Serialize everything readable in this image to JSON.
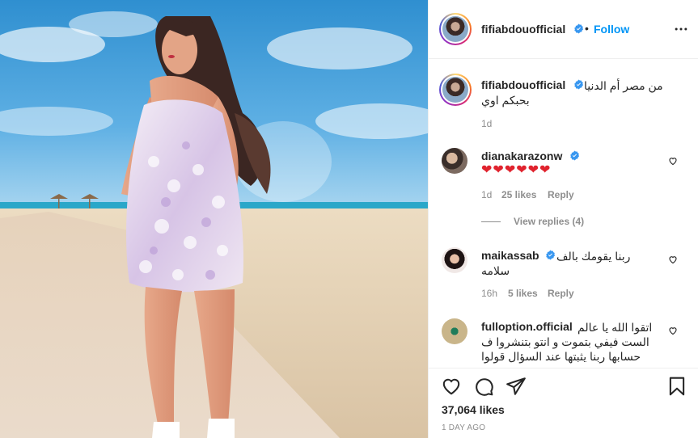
{
  "post": {
    "author": "fifiabdouofficial",
    "follow_label": "Follow",
    "separator": "•",
    "caption": {
      "line1": "من مصر أم الدنيا",
      "line2": "بحبكم اوي",
      "time": "1d"
    }
  },
  "comments": [
    {
      "username": "dianakarazonw",
      "text": "❤❤❤❤❤❤",
      "time": "1d",
      "likes": "25 likes",
      "reply_label": "Reply",
      "view_replies": "View replies (4)"
    },
    {
      "username": "maikassab",
      "line1": "ربنا يقومك بالف",
      "line2": "سلامه",
      "time": "16h",
      "likes": "5 likes",
      "reply_label": "Reply"
    },
    {
      "username": "fulloption.official",
      "line1": "اتقوا الله يا عالم",
      "line2": "الست فيفي بتموت و انتو بتنشروا ف",
      "line3": "حسابها ربنا يثبتها عند السؤال قولوا"
    }
  ],
  "footer": {
    "likes": "37,064 likes",
    "date": "1 DAY AGO"
  },
  "icons": {
    "verified": "verified-badge-icon",
    "more": "more-options-icon",
    "like": "heart-icon",
    "comment": "comment-bubble-icon",
    "share": "paper-plane-icon",
    "save": "bookmark-icon"
  },
  "colors": {
    "accent": "#0095f6",
    "verified": "#3897f0",
    "muted": "#8e8e8e",
    "text": "#262626"
  }
}
